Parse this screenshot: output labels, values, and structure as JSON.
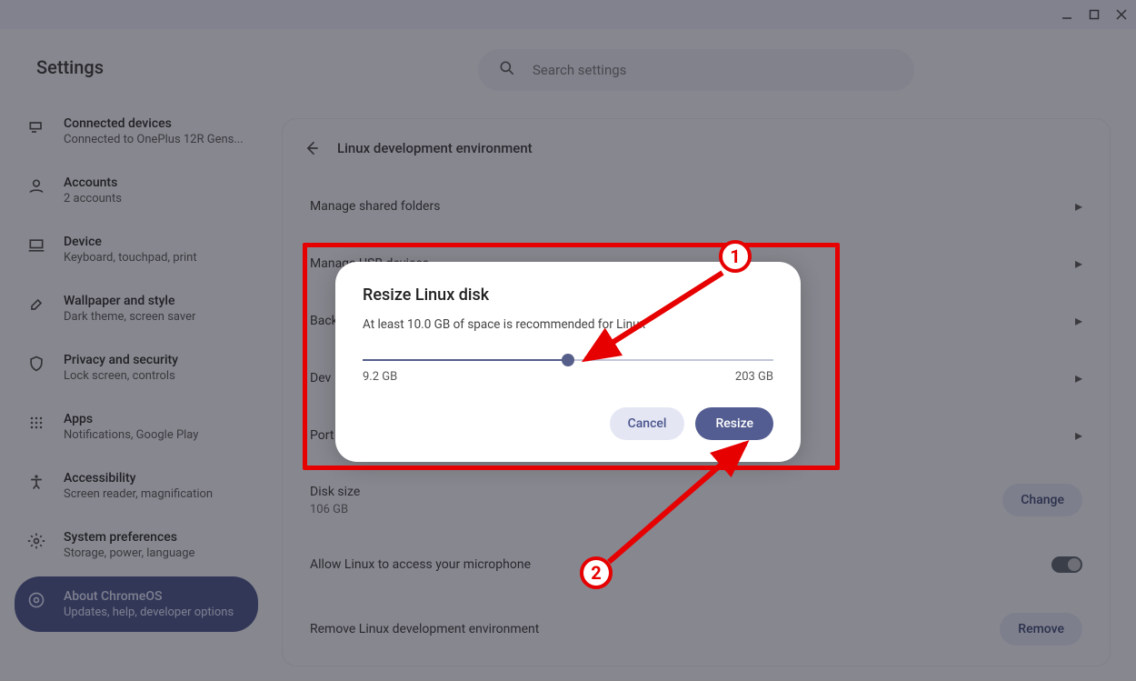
{
  "window": {
    "title": ""
  },
  "app_title": "Settings",
  "search": {
    "placeholder": "Search settings"
  },
  "sidebar": {
    "items": [
      {
        "title": "Connected devices",
        "sub": "Connected to OnePlus 12R Gens..."
      },
      {
        "title": "Accounts",
        "sub": "2 accounts"
      },
      {
        "title": "Device",
        "sub": "Keyboard, touchpad, print"
      },
      {
        "title": "Wallpaper and style",
        "sub": "Dark theme, screen saver"
      },
      {
        "title": "Privacy and security",
        "sub": "Lock screen, controls"
      },
      {
        "title": "Apps",
        "sub": "Notifications, Google Play"
      },
      {
        "title": "Accessibility",
        "sub": "Screen reader, magnification"
      },
      {
        "title": "System preferences",
        "sub": "Storage, power, language"
      },
      {
        "title": "About ChromeOS",
        "sub": "Updates, help, developer options"
      }
    ]
  },
  "main": {
    "header_title": "Linux development environment",
    "rows": {
      "shared": "Manage shared folders",
      "usb": "Manage USB devices",
      "back": "Back",
      "dev": "Dev",
      "port": "Port",
      "disk_title": "Disk size",
      "disk_value": "106 GB",
      "change_btn": "Change",
      "mic": "Allow Linux to access your microphone",
      "remove_title": "Remove Linux development environment",
      "remove_btn": "Remove"
    }
  },
  "dialog": {
    "title": "Resize Linux disk",
    "text": "At least 10.0 GB of space is recommended for Linux",
    "min_label": "9.2 GB",
    "max_label": "203 GB",
    "cancel": "Cancel",
    "confirm": "Resize"
  },
  "annotations": {
    "n1": "1",
    "n2": "2"
  }
}
